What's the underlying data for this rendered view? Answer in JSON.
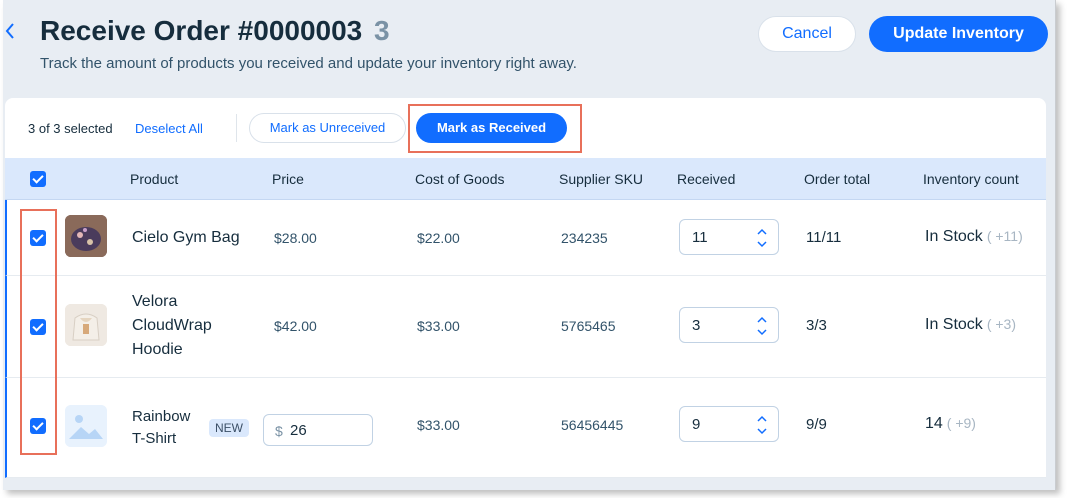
{
  "header": {
    "back_icon": "chevron-left-icon",
    "title": "Receive Order #0000003",
    "count": "3",
    "subtitle": "Track the amount of products you received and update your inventory right away.",
    "cancel_label": "Cancel",
    "update_label": "Update Inventory"
  },
  "toolbar": {
    "selected_text": "3 of 3 selected",
    "deselect_label": "Deselect All",
    "mark_unreceived_label": "Mark as Unreceived",
    "mark_received_label": "Mark as Received"
  },
  "table": {
    "columns": [
      "Product",
      "Price",
      "Cost of Goods",
      "Supplier SKU",
      "Received",
      "Order total",
      "Inventory count"
    ],
    "header_checked": true,
    "rows": [
      {
        "checked": true,
        "name": "Cielo Gym Bag",
        "price": "$28.00",
        "cost": "$22.00",
        "sku": "234235",
        "received": "11",
        "order_total": "11/11",
        "inventory": "In Stock",
        "inventory_delta": "( +11)"
      },
      {
        "checked": true,
        "name_lines": [
          "Velora",
          "CloudWrap",
          "Hoodie"
        ],
        "price": "$42.00",
        "cost": "$33.00",
        "sku": "5765465",
        "received": "3",
        "order_total": "3/3",
        "inventory": "In Stock",
        "inventory_delta": "( +3)"
      },
      {
        "checked": true,
        "name_lines": [
          "Rainbow",
          "T-Shirt"
        ],
        "badge": "NEW",
        "price_currency": "$",
        "price_value": "26",
        "cost": "$33.00",
        "sku": "56456445",
        "received": "9",
        "order_total": "9/9",
        "inventory": "14",
        "inventory_delta": "( +9)"
      }
    ]
  },
  "colors": {
    "accent": "#116dff",
    "highlight": "#e8705a",
    "header_bg": "#dae8fc",
    "page_bg": "#e8edf3"
  }
}
